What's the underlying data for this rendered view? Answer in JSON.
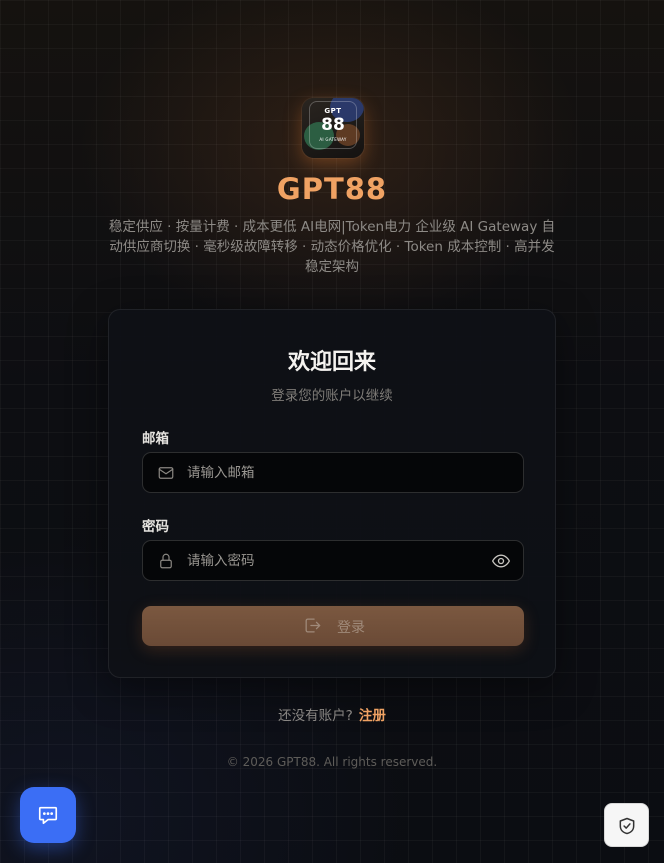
{
  "brand": {
    "logo_top": "GPT",
    "logo_main": "88",
    "logo_bottom": "AI GATEWAY",
    "name": "GPT88",
    "tagline": "稳定供应 · 按量计费 · 成本更低 AI电网|Token电力 企业级 AI Gateway 自动供应商切换 · 毫秒级故障转移 · 动态价格优化 · Token 成本控制 · 高并发稳定架构"
  },
  "login": {
    "title": "欢迎回来",
    "subtitle": "登录您的账户以继续",
    "email_label": "邮箱",
    "email_placeholder": "请输入邮箱",
    "email_value": "",
    "password_label": "密码",
    "password_placeholder": "请输入密码",
    "password_value": "",
    "submit_label": "登录"
  },
  "signup": {
    "prompt": "还没有账户?",
    "link": "注册"
  },
  "footer": {
    "copyright": "© 2026 GPT88. All rights reserved."
  },
  "icons": {
    "email": "mail-icon",
    "password": "lock-icon",
    "toggle": "eye-icon",
    "submit": "login-icon",
    "chat": "chat-icon",
    "security": "shield-check-icon"
  },
  "colors": {
    "accent": "#f0a263",
    "chat_button": "#3b6ef5"
  }
}
